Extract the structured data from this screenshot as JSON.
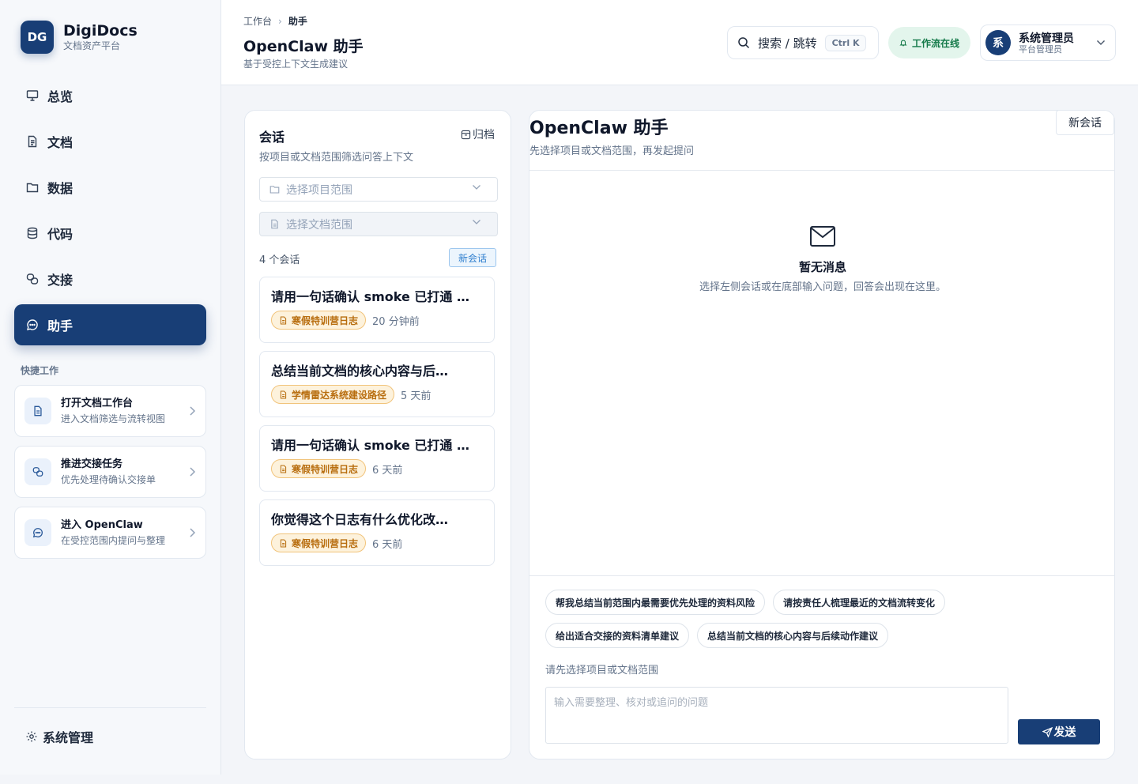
{
  "brand": {
    "logo": "DG",
    "name": "DigiDocs",
    "subtitle": "文档资产平台"
  },
  "nav": [
    {
      "label": "总览",
      "icon": "monitor-icon",
      "active": false
    },
    {
      "label": "文档",
      "icon": "file-icon",
      "active": false
    },
    {
      "label": "数据",
      "icon": "folder-icon",
      "active": false
    },
    {
      "label": "代码",
      "icon": "database-icon",
      "active": false
    },
    {
      "label": "交接",
      "icon": "handoff-icon",
      "active": false
    },
    {
      "label": "助手",
      "icon": "chat-icon",
      "active": true
    }
  ],
  "quick_work": {
    "title": "快捷工作",
    "items": [
      {
        "title": "打开文档工作台",
        "subtitle": "进入文档筛选与流转视图",
        "icon": "document-icon"
      },
      {
        "title": "推进交接任务",
        "subtitle": "优先处理待确认交接单",
        "icon": "handoff-icon"
      },
      {
        "title": "进入 OpenClaw",
        "subtitle": "在受控范围内提问与整理",
        "icon": "chat-icon"
      }
    ]
  },
  "system_admin": "系统管理",
  "header": {
    "breadcrumb": [
      "工作台",
      "助手"
    ],
    "title": "OpenClaw 助手",
    "subtitle": "基于受控上下文生成建议",
    "search_label": "搜索 / 跳转",
    "search_shortcut": "Ctrl K",
    "workflow_status": "工作流在线",
    "user": {
      "avatar": "系",
      "name": "系统管理员",
      "role": "平台管理员"
    }
  },
  "conversations": {
    "title": "会话",
    "archive_label": "归档",
    "subtitle": "按项目或文档范围筛选问答上下文",
    "project_placeholder": "选择项目范围",
    "doc_placeholder": "选择文档范围",
    "count_label": "4 个会话",
    "new_label": "新会话",
    "items": [
      {
        "title": "请用一句话确认 smoke 已打通 …",
        "tag": "寒假特训营日志",
        "time": "20 分钟前"
      },
      {
        "title": "总结当前文档的核心内容与后…",
        "tag": "学情雷达系统建设路径",
        "time": "5 天前"
      },
      {
        "title": "请用一句话确认 smoke 已打通 …",
        "tag": "寒假特训营日志",
        "time": "6 天前"
      },
      {
        "title": "你觉得这个日志有什么优化改…",
        "tag": "寒假特训营日志",
        "time": "6 天前"
      }
    ]
  },
  "chat": {
    "title": "OpenClaw 助手",
    "subtitle": "先选择项目或文档范围，再发起提问",
    "new_conversation": "新会话",
    "empty_title": "暂无消息",
    "empty_subtitle": "选择左侧会话或在底部输入问题，回答会出现在这里。",
    "suggestions": [
      "帮我总结当前范围内最需要优先处理的资料风险",
      "请按责任人梳理最近的文档流转变化",
      "给出适合交接的资料清单建议",
      "总结当前文档的核心内容与后续动作建议"
    ],
    "hint": "请先选择项目或文档范围",
    "input_placeholder": "输入需要整理、核对或追问的问题",
    "send_label": "发送"
  },
  "colors": {
    "primary": "#183e76",
    "online_bg": "#e3f5ec",
    "online_text": "#157a4a",
    "tag_bg": "#fdf2dc",
    "tag_text": "#b86d0e",
    "link_blue": "#2f7fce"
  }
}
